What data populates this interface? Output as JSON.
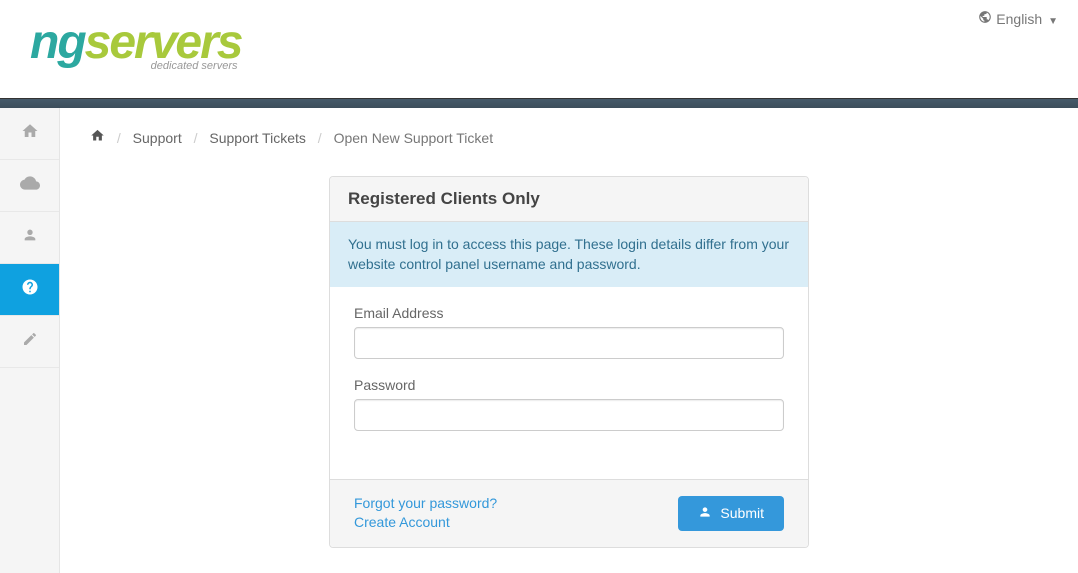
{
  "header": {
    "logo_ng": "ng",
    "logo_servers": "servers",
    "logo_sub": "dedicated servers",
    "language": "English"
  },
  "sidebar": {
    "items": [
      {
        "name": "home",
        "active": false
      },
      {
        "name": "cloud",
        "active": false
      },
      {
        "name": "user",
        "active": false
      },
      {
        "name": "help",
        "active": true
      },
      {
        "name": "edit",
        "active": false
      }
    ]
  },
  "breadcrumb": {
    "items": [
      "Support",
      "Support Tickets",
      "Open New Support Ticket"
    ]
  },
  "card": {
    "title": "Registered Clients Only",
    "alert": "You must log in to access this page. These login details differ from your website control panel username and password.",
    "email_label": "Email Address",
    "password_label": "Password",
    "forgot_link": "Forgot your password?",
    "create_link": "Create Account",
    "submit_label": "Submit"
  }
}
